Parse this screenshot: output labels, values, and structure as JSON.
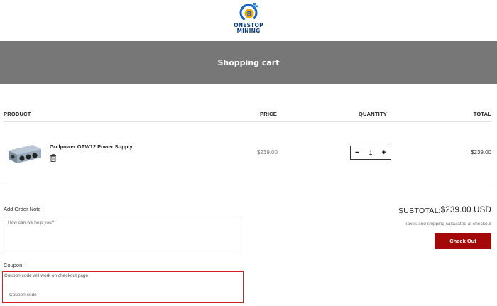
{
  "brand": {
    "line1": "ONESTOP",
    "line2": "MINING",
    "logo_colors": {
      "ring": "#1565c0",
      "coin": "#f2a900",
      "dots": "#1e88e5"
    }
  },
  "banner": {
    "title": "Shopping cart"
  },
  "table": {
    "headers": {
      "product": "PRODUCT",
      "price": "PRICE",
      "quantity": "QUANTITY",
      "total": "TOTAL"
    }
  },
  "items": [
    {
      "name": "Gullpower GPW12 Power Supply",
      "price": "$239.00",
      "quantity": "1",
      "total": "$239.00",
      "thumbnail_icon": "power-supply-image",
      "remove_icon": "trash-icon",
      "decrement": "−",
      "increment": "+"
    }
  ],
  "order_note": {
    "label": "Add Order Note",
    "placeholder": "How can we help you?"
  },
  "coupon": {
    "label": "Coupon:",
    "hint": "Coupon code will work on checkout page",
    "placeholder": "Coupon code"
  },
  "summary": {
    "subtotal_label": "SUBTOTAL:",
    "subtotal_value": "$239.00 USD",
    "tax_note": "Taxes and shipping calculated at checkout",
    "checkout_label": "Check Out"
  },
  "colors": {
    "banner_bg": "#777777",
    "checkout_bg": "#a50808",
    "coupon_highlight": "#d62020"
  }
}
